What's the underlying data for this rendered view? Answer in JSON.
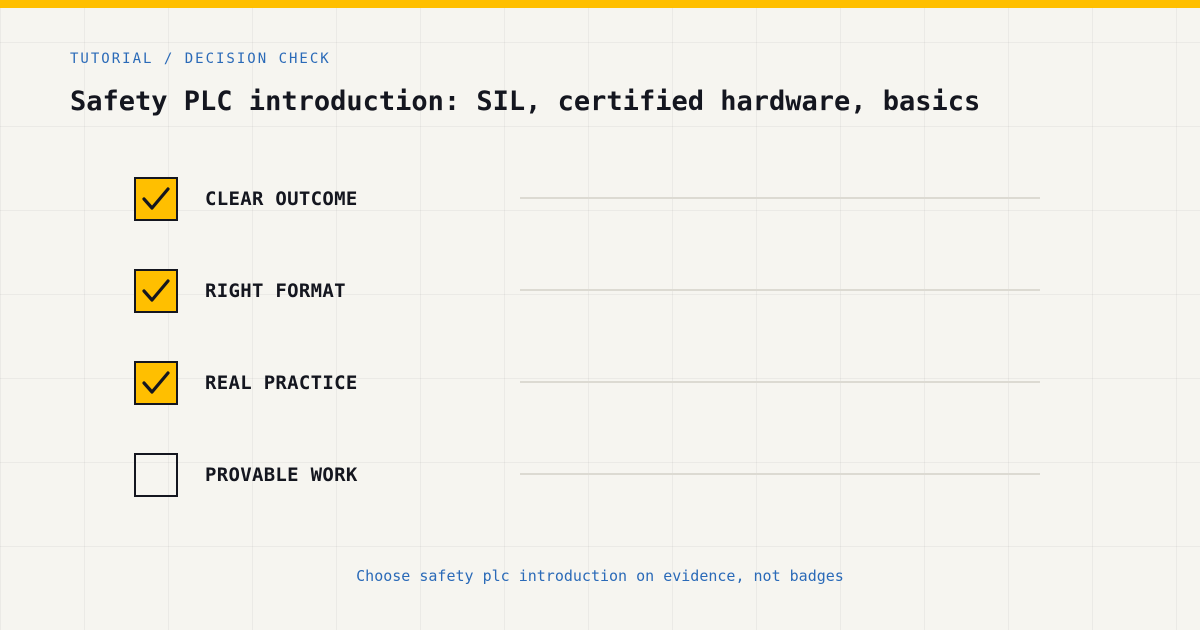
{
  "colors": {
    "accent": "#ffbf00",
    "link": "#2a6ab8",
    "ink": "#14161f",
    "background": "#f6f5f0"
  },
  "header": {
    "eyebrow": "TUTORIAL / DECISION CHECK",
    "title": "Safety PLC introduction: SIL, certified hardware, basics"
  },
  "checklist": {
    "items": [
      {
        "label": "CLEAR OUTCOME",
        "checked": true
      },
      {
        "label": "RIGHT FORMAT",
        "checked": true
      },
      {
        "label": "REAL PRACTICE",
        "checked": true
      },
      {
        "label": "PROVABLE WORK",
        "checked": false
      }
    ]
  },
  "footer": {
    "note": "Choose safety plc introduction on evidence, not badges"
  }
}
